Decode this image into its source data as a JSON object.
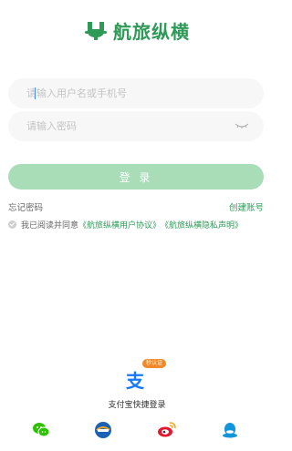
{
  "brand": {
    "name": "航旅纵横",
    "color": "#2e9a58"
  },
  "login_form": {
    "username_placeholder": "请输入用户名或手机号",
    "password_placeholder": "请输入密码",
    "login_label": "登 录",
    "button_color": "#a8ddb7"
  },
  "links": {
    "forgot_password": "忘记密码",
    "create_account": "创建账号"
  },
  "agreement": {
    "prefix": "我已阅读并同意",
    "user_agreement": "《航旅纵横用户协议》",
    "privacy_policy": "《航旅纵横隐私声明》"
  },
  "alipay": {
    "badge": "秒认证",
    "label": "支付宝快捷登录",
    "icon": "alipay-icon"
  },
  "social_logins": [
    {
      "icon": "wechat-icon",
      "color": "#2dc100"
    },
    {
      "icon": "ctrip-icon",
      "color": "#1b62b6"
    },
    {
      "icon": "weibo-icon",
      "color": "#e6162d"
    },
    {
      "icon": "qq-icon",
      "color": "#1296db"
    }
  ]
}
